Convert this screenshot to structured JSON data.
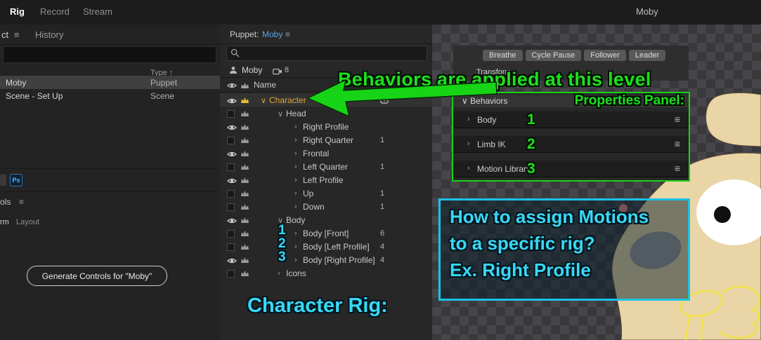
{
  "topbar": {
    "tabs": [
      {
        "label": "Rig"
      },
      {
        "label": "Record"
      },
      {
        "label": "Stream"
      }
    ],
    "document": "Moby"
  },
  "icons": {
    "menu": "≡",
    "sort": "↑"
  },
  "left": {
    "project_tab_partial": "ct",
    "history_tab": "History",
    "type_column": "Type",
    "rows": [
      {
        "name": "Moby",
        "type": "Puppet",
        "selected": true
      },
      {
        "name": "Scene - Set Up",
        "type": "Scene",
        "selected": false
      }
    ],
    "ps_badge": "Ps",
    "controls_title_partial": "ols",
    "transform_tab_partial": "rm",
    "layout_tab": "Layout",
    "generate_button": "Generate Controls for \"Moby\""
  },
  "puppet": {
    "panel_label": "Puppet:",
    "panel_target": "Moby",
    "owner_name": "Moby",
    "takes_count": "8",
    "name_column": "Name",
    "rows": [
      {
        "arrow": "∨",
        "label": "Character",
        "eye": true,
        "crown": "gold",
        "selected": true
      },
      {
        "arrow": "∨",
        "label": "Head",
        "eye": false
      },
      {
        "arrow": "›",
        "label": "Right Profile",
        "eye": true
      },
      {
        "arrow": "›",
        "label": "Right Quarter",
        "count": "1",
        "eye": false
      },
      {
        "arrow": "›",
        "label": "Frontal",
        "eye": true
      },
      {
        "arrow": "›",
        "label": "Left Quarter",
        "count": "1",
        "eye": false
      },
      {
        "arrow": "›",
        "label": "Left Profile",
        "eye": true
      },
      {
        "arrow": "›",
        "label": "Up",
        "count": "1",
        "eye": false
      },
      {
        "arrow": "›",
        "label": "Down",
        "count": "1",
        "eye": false
      },
      {
        "arrow": "∨",
        "label": "Body",
        "eye": true
      },
      {
        "arrow": "›",
        "label": "Body [Front]",
        "count": "6",
        "eye": false
      },
      {
        "arrow": "›",
        "label": "Body [Left Profile]",
        "count": "4",
        "eye": false
      },
      {
        "arrow": "›",
        "label": "Body [Right Profile]",
        "count": "4",
        "eye": true
      },
      {
        "arrow": "›",
        "label": "Icons",
        "eye": false
      }
    ]
  },
  "props": {
    "buttons": [
      {
        "label": "Breathe"
      },
      {
        "label": "Cycle Pause"
      },
      {
        "label": "Follower"
      },
      {
        "label": "Leader"
      }
    ],
    "transform": "Transform",
    "header_arrow": "∨",
    "behaviors_header": "Behaviors",
    "items": [
      {
        "arrow": "›",
        "label": "Body"
      },
      {
        "arrow": "›",
        "label": "Limb IK"
      },
      {
        "arrow": "›",
        "label": "Motion Library"
      }
    ]
  },
  "ann": {
    "green_title": "Behaviors are applied at this level",
    "green_caption": "Properties Panel:",
    "g1": "1",
    "g2": "2",
    "g3": "3",
    "cyan_line1": "How to assign Motions",
    "cyan_line2": "to a specific rig?",
    "cyan_line3": "Ex. Right Profile",
    "cyan_caption": "Character Rig:",
    "c1": "1",
    "c2": "2",
    "c3": "3"
  },
  "colors": {
    "accent_green": "#1fdf1f",
    "accent_cyan": "#39d8f7",
    "link_blue": "#57a3e4",
    "crown_gold": "#e6c23a",
    "selected_layer_text": "#e0a33c"
  }
}
